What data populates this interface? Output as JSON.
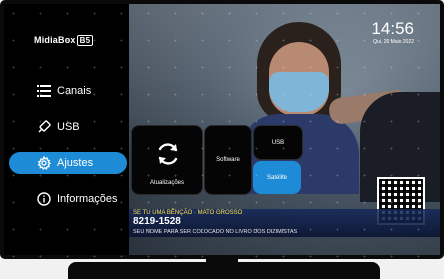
{
  "brand": {
    "logo_text": "MidiaBox",
    "logo_badge": "B5"
  },
  "clock": {
    "time": "14:56",
    "date": "Qui, 26 Maio 2022"
  },
  "sidebar": {
    "items": [
      {
        "label": "Canais",
        "icon": "list-icon",
        "active": false
      },
      {
        "label": "USB",
        "icon": "usb-icon",
        "active": false
      },
      {
        "label": "Ajustes",
        "icon": "gear-icon",
        "active": true
      },
      {
        "label": "Informações",
        "icon": "info-icon",
        "active": false
      }
    ]
  },
  "settings_tiles": {
    "updates": "Atualizações",
    "software": "Software",
    "usb": "USB",
    "satellite": "Satélite"
  },
  "background_video": {
    "ticker_line1": "SE TU UMA BÊNÇÃO · MATO GROSSO",
    "ticker_phone": "8219-1528",
    "ticker_line3": "SEU NOME PARA SER COLOCADO NO LIVRO DOS DIZIMISTAS"
  },
  "colors": {
    "accent": "#1e8bd6",
    "sidebar_bg": "#000000",
    "tile_bg": "#050505"
  }
}
